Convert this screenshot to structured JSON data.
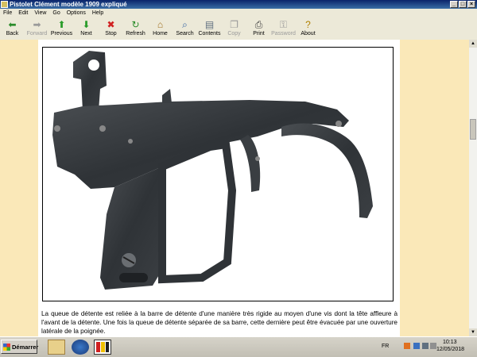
{
  "window": {
    "title": "Pistolet Clément modèle 1909 expliqué"
  },
  "menu": [
    "File",
    "Edit",
    "View",
    "Go",
    "Options",
    "Help"
  ],
  "toolbar": [
    {
      "label": "Back",
      "icon": "back-arrow-icon",
      "glyph": "⬅",
      "color": "#2a8c2a",
      "enabled": true
    },
    {
      "label": "Forward",
      "icon": "forward-arrow-icon",
      "glyph": "➡",
      "color": "#9a9a9a",
      "enabled": false
    },
    {
      "label": "Previous",
      "icon": "up-arrow-icon",
      "glyph": "⬆",
      "color": "#2a9c2a",
      "enabled": true
    },
    {
      "label": "Next",
      "icon": "down-arrow-icon",
      "glyph": "⬇",
      "color": "#2a9c2a",
      "enabled": true
    },
    {
      "label": "Stop",
      "icon": "stop-icon",
      "glyph": "✖",
      "color": "#d02020",
      "enabled": true
    },
    {
      "label": "Refresh",
      "icon": "refresh-icon",
      "glyph": "↻",
      "color": "#2a8c2a",
      "enabled": true
    },
    {
      "label": "Home",
      "icon": "home-icon",
      "glyph": "⌂",
      "color": "#a07020",
      "enabled": true
    },
    {
      "label": "Search",
      "icon": "search-icon",
      "glyph": "⌕",
      "color": "#3060a0",
      "enabled": true
    },
    {
      "label": "Contents",
      "icon": "contents-icon",
      "glyph": "▤",
      "color": "#607080",
      "enabled": true
    },
    {
      "label": "Copy",
      "icon": "copy-icon",
      "glyph": "❐",
      "color": "#9a9a9a",
      "enabled": false
    },
    {
      "label": "Print",
      "icon": "print-icon",
      "glyph": "⎙",
      "color": "#404040",
      "enabled": true
    },
    {
      "label": "Password",
      "icon": "key-icon",
      "glyph": "⚿",
      "color": "#9a9a9a",
      "enabled": false
    },
    {
      "label": "About",
      "icon": "about-icon",
      "glyph": "?",
      "color": "#b08000",
      "enabled": true
    }
  ],
  "caption": "La queue de détente est reliée à la barre de détente d'une manière très rigide au moyen d'une vis dont la tête affleure à l'avant de la détente. Une fois la queue de détente séparée de sa barre, cette dernière peut être évacuée par une ouverture latérale de la poignée.",
  "taskbar": {
    "start_label": "Démarrer",
    "language": "FR",
    "time": "10:13",
    "date": "12/05/2018"
  }
}
